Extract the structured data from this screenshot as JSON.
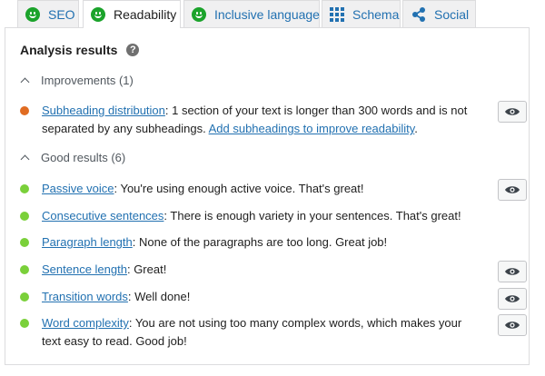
{
  "tabs": [
    {
      "label": "SEO",
      "icon": "smiley-icon"
    },
    {
      "label": "Readability",
      "icon": "smiley-icon"
    },
    {
      "label": "Inclusive language",
      "icon": "smiley-icon"
    },
    {
      "label": "Schema",
      "icon": "grid-icon"
    },
    {
      "label": "Social",
      "icon": "share-icon"
    }
  ],
  "colors": {
    "good": "#7ad03a",
    "improve": "#e06c22",
    "smiley": "#1ba32b",
    "link": "#2271b1"
  },
  "panel": {
    "title": "Analysis results",
    "help": "?",
    "improvements": {
      "label": "Improvements (1)",
      "items": [
        {
          "link": "Subheading distribution",
          "text": ": 1 section of your text is longer than 300 words and is not separated by any subheadings. ",
          "extra_link": "Add subheadings to improve readability",
          "tail": "."
        }
      ]
    },
    "good": {
      "label": "Good results (6)",
      "items": [
        {
          "link": "Passive voice",
          "text": ": You're using enough active voice. That's great!"
        },
        {
          "link": "Consecutive sentences",
          "text": ": There is enough variety in your sentences. That's great!"
        },
        {
          "link": "Paragraph length",
          "text": ": None of the paragraphs are too long. Great job!"
        },
        {
          "link": "Sentence length",
          "text": ": Great!"
        },
        {
          "link": "Transition words",
          "text": ": Well done!"
        },
        {
          "link": "Word complexity",
          "text": ": You are not using too many complex words, which makes your text easy to read. Good job!"
        }
      ]
    }
  }
}
